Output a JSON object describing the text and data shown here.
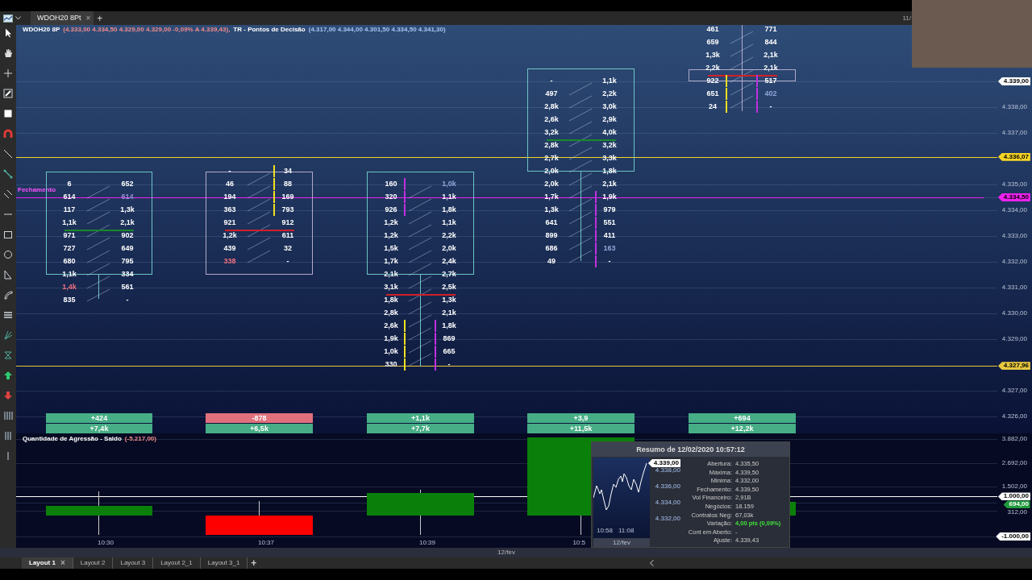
{
  "chart_tab": {
    "label": "WDOH20 8Pt",
    "close": "×"
  },
  "add_tab": "+",
  "clock_partial": "11/",
  "legend": {
    "symbol": "WDOH20 8P",
    "symbol_values": "(4.333,00  4.334,50  4.329,00  4.329,00  -0,09%  A 4.339,43),",
    "indicator": "TR - Pontos de Decisão",
    "indicator_values": "(4.317,00  4.344,00  4.301,50  4.334,50  4.341,30)"
  },
  "close_label": "Fechamento",
  "price_axis": [
    {
      "label": "4.339,00",
      "kind": "tag",
      "color": "#ffffff",
      "guide_line": false
    },
    {
      "label": "4.338,00",
      "kind": "tick"
    },
    {
      "label": "4.337,00",
      "kind": "tick"
    },
    {
      "label": "4.336,07",
      "kind": "tag",
      "color": "#f5d327",
      "guide_line": true
    },
    {
      "label": "4.335,00",
      "kind": "tick"
    },
    {
      "label": "4.334,50",
      "kind": "tag",
      "color": "#ee22ee",
      "guide_line": true
    },
    {
      "label": "4.334,00",
      "kind": "tick"
    },
    {
      "label": "4.333,00",
      "kind": "tick"
    },
    {
      "label": "4.332,00",
      "kind": "tick"
    },
    {
      "label": "4.331,00",
      "kind": "tick"
    },
    {
      "label": "4.330,00",
      "kind": "tick"
    },
    {
      "label": "4.329,00",
      "kind": "tick"
    },
    {
      "label": "4.327,96",
      "kind": "tag",
      "color": "#e8c840",
      "guide_line": true
    },
    {
      "label": "4.327,00",
      "kind": "tick"
    },
    {
      "label": "4.326,00",
      "kind": "tick"
    }
  ],
  "candles": [
    {
      "bullish": true,
      "poc_line": {
        "color": "#1a8a2a"
      },
      "delta": {
        "text": "+424",
        "positive": true
      },
      "total": "+7,4k",
      "rows": [
        {
          "bid": "6",
          "ask": "652",
          "poc": false
        },
        {
          "bid": "614",
          "ask": "614",
          "poc": false,
          "ask_highlight": {
            "color": "#9d8fd8"
          }
        },
        {
          "bid": "117",
          "ask": "1,3k",
          "poc": false
        },
        {
          "bid": "1,1k",
          "ask": "2,1k",
          "poc": false
        },
        {
          "bid": "971",
          "ask": "902",
          "poc": true
        },
        {
          "bid": "727",
          "ask": "649",
          "poc": false
        },
        {
          "bid": "680",
          "ask": "795",
          "poc": false
        },
        {
          "bid": "1,1k",
          "ask": "334",
          "poc": false
        },
        {
          "bid": "1,4k",
          "ask": "561",
          "poc": false,
          "bid_highlight": {
            "color": "#f07080"
          }
        },
        {
          "bid": "835",
          "ask": "-",
          "poc": false
        }
      ]
    },
    {
      "bullish": false,
      "poc_line": {
        "color": "#d0202a"
      },
      "delta": {
        "text": "-878",
        "positive": false
      },
      "total": "+6,5k",
      "rows": [
        {
          "bid": "-",
          "ask": "34",
          "poc": false,
          "ask_bar": {
            "color": "#f0e020"
          }
        },
        {
          "bid": "46",
          "ask": "88",
          "poc": false,
          "ask_bar": {
            "color": "#f0e020"
          }
        },
        {
          "bid": "194",
          "ask": "169",
          "poc": false,
          "ask_bar": {
            "color": "#f0e020"
          }
        },
        {
          "bid": "363",
          "ask": "793",
          "poc": false,
          "ask_bar": {
            "color": "#f0e020"
          }
        },
        {
          "bid": "921",
          "ask": "912",
          "poc": false
        },
        {
          "bid": "1,2k",
          "ask": "611",
          "poc": true
        },
        {
          "bid": "439",
          "ask": "32",
          "poc": false
        },
        {
          "bid": "338",
          "ask": "-",
          "poc": false,
          "bid_highlight": {
            "color": "#f07080"
          }
        }
      ]
    },
    {
      "bullish": true,
      "poc_line": {
        "color": "#d0202a"
      },
      "delta": {
        "text": "+1,1k",
        "positive": true
      },
      "total": "+7,7k",
      "rows": [
        {
          "bid": "160",
          "ask": "1,0k",
          "poc": false,
          "bid_bar": {
            "color": "#c030e0"
          },
          "ask_highlight": {
            "color": "#8fa5d8"
          }
        },
        {
          "bid": "320",
          "ask": "1,1k",
          "poc": false,
          "bid_bar": {
            "color": "#c030e0"
          }
        },
        {
          "bid": "926",
          "ask": "1,8k",
          "poc": false,
          "bid_bar": {
            "color": "#c030e0"
          }
        },
        {
          "bid": "1,2k",
          "ask": "1,1k",
          "poc": false
        },
        {
          "bid": "1,2k",
          "ask": "2,2k",
          "poc": false
        },
        {
          "bid": "1,5k",
          "ask": "2,0k",
          "poc": false
        },
        {
          "bid": "1,7k",
          "ask": "2,4k",
          "poc": false
        },
        {
          "bid": "2,1k",
          "ask": "2,7k",
          "poc": false
        },
        {
          "bid": "3,1k",
          "ask": "2,5k",
          "poc": false
        },
        {
          "bid": "1,8k",
          "ask": "1,3k",
          "poc": true
        },
        {
          "bid": "2,8k",
          "ask": "2,1k",
          "poc": false
        },
        {
          "bid": "2,6k",
          "ask": "1,8k",
          "poc": false,
          "bid_bar": {
            "color": "#f0e020"
          },
          "ask_bar": {
            "color": "#c030e0"
          }
        },
        {
          "bid": "1,9k",
          "ask": "869",
          "poc": false,
          "bid_bar": {
            "color": "#f0e020"
          },
          "ask_bar": {
            "color": "#c030e0"
          }
        },
        {
          "bid": "1,0k",
          "ask": "665",
          "poc": false,
          "bid_bar": {
            "color": "#f0e020"
          },
          "ask_bar": {
            "color": "#c030e0"
          }
        },
        {
          "bid": "330",
          "ask": "-",
          "poc": false,
          "bid_bar": {
            "color": "#f0e020"
          },
          "ask_bar": {
            "color": "#c030e0"
          }
        }
      ]
    },
    {
      "bullish": true,
      "poc_line": {
        "color": "#1a8a2a"
      },
      "delta": {
        "text": "+3,9",
        "positive": true
      },
      "total": "+11,5k",
      "rows": [
        {
          "bid": "-",
          "ask": "1,1k",
          "poc": false
        },
        {
          "bid": "497",
          "ask": "2,2k",
          "poc": false
        },
        {
          "bid": "2,8k",
          "ask": "3,0k",
          "poc": false
        },
        {
          "bid": "2,6k",
          "ask": "2,9k",
          "poc": false
        },
        {
          "bid": "3,2k",
          "ask": "4,0k",
          "poc": false
        },
        {
          "bid": "2,8k",
          "ask": "3,2k",
          "poc": true
        },
        {
          "bid": "2,7k",
          "ask": "3,3k",
          "poc": false
        },
        {
          "bid": "2,0k",
          "ask": "1,8k",
          "poc": false
        },
        {
          "bid": "2,0k",
          "ask": "2,1k",
          "poc": false
        },
        {
          "bid": "1,7k",
          "ask": "1,9k",
          "poc": false,
          "ask_bar": {
            "color": "#c030e0"
          }
        },
        {
          "bid": "1,3k",
          "ask": "979",
          "poc": false,
          "ask_bar": {
            "color": "#c030e0"
          }
        },
        {
          "bid": "641",
          "ask": "551",
          "poc": false,
          "ask_bar": {
            "color": "#c030e0"
          }
        },
        {
          "bid": "899",
          "ask": "411",
          "poc": false,
          "ask_bar": {
            "color": "#c030e0"
          }
        },
        {
          "bid": "686",
          "ask": "163",
          "poc": false,
          "ask_bar": {
            "color": "#c030e0"
          },
          "ask_highlight": {
            "color": "#8fa5d8"
          }
        },
        {
          "bid": "49",
          "ask": "-",
          "poc": false,
          "ask_bar": {
            "color": "#c030e0"
          }
        }
      ]
    },
    {
      "bullish": false,
      "poc_line": {
        "color": "#d0202a"
      },
      "delta": {
        "text": "+694",
        "positive": true
      },
      "total": "+12,2k",
      "rows": [
        {
          "bid": "461",
          "ask": "771",
          "poc": false
        },
        {
          "bid": "659",
          "ask": "844",
          "poc": false
        },
        {
          "bid": "1,3k",
          "ask": "2,1k",
          "poc": false
        },
        {
          "bid": "2,2k",
          "ask": "2,1k",
          "poc": false
        },
        {
          "bid": "922",
          "ask": "517",
          "poc": true,
          "bid_bar": {
            "color": "#f0e020"
          },
          "ask_bar": {
            "color": "#c030e0"
          }
        },
        {
          "bid": "651",
          "ask": "402",
          "poc": false,
          "bid_bar": {
            "color": "#f0e020"
          },
          "ask_bar": {
            "color": "#c030e0"
          },
          "ask_highlight": {
            "color": "#8fa5d8"
          }
        },
        {
          "bid": "24",
          "ask": "-",
          "poc": false,
          "bid_bar": {
            "color": "#f0e020"
          },
          "ask_bar": {
            "color": "#c030e0"
          }
        }
      ]
    }
  ],
  "lower_panel": {
    "title": "Quantidade de Agressão - Saldo",
    "value": "(-5.217,00)",
    "axis": [
      {
        "label": "3.882,00",
        "kind": "tick"
      },
      {
        "label": "2.692,00",
        "kind": "tick"
      },
      {
        "label": "1.502,00",
        "kind": "tick"
      },
      {
        "label": "1.000,00",
        "kind": "tag",
        "color": "#ffffff",
        "guide_line": true
      },
      {
        "label": "694,00",
        "kind": "tag",
        "color": "#1f9a3a",
        "guide_line": false
      },
      {
        "label": "312,00",
        "kind": "tick"
      },
      {
        "label": "-1.000,00",
        "kind": "tag",
        "color": "#ffffff",
        "guide_line": false
      }
    ]
  },
  "time_labels": [
    "10:30",
    "10:37",
    "10:39",
    "10:5"
  ],
  "date_label": "12/fev",
  "tooltip": {
    "title": "Resumo de 12/02/2020 10:57:12",
    "mini_axis": [
      {
        "label": "4.339,00",
        "kind": "tag"
      },
      {
        "label": "4.338,00",
        "kind": "tick"
      },
      {
        "label": "4.336,00",
        "kind": "tick"
      },
      {
        "label": "4.334,00",
        "kind": "tick"
      },
      {
        "label": "4.332,00",
        "kind": "tick"
      }
    ],
    "mini_times": [
      "10:58",
      "11:08"
    ],
    "mini_date": "12/fev",
    "fields": [
      {
        "label": "Abertura:",
        "value": "4.335,50",
        "emphasis": false
      },
      {
        "label": "Máxima:",
        "value": "4.339,50",
        "emphasis": false
      },
      {
        "label": "Minima:",
        "value": "4.332,00",
        "emphasis": false
      },
      {
        "label": "Fechamento:",
        "value": "4.339,50",
        "emphasis": false
      },
      {
        "label": "Vol Financeiro:",
        "value": "2,91B",
        "emphasis": false
      },
      {
        "label": "Negócios:",
        "value": "18.159",
        "emphasis": false
      },
      {
        "label": "Contratos Neg:",
        "value": "67,03k",
        "emphasis": false
      },
      {
        "label": "Variação:",
        "value": "4,00 pts (0,09%)",
        "emphasis": true
      },
      {
        "label": "Cont em Aberto:",
        "value": "-",
        "emphasis": false
      },
      {
        "label": "Ajuste:",
        "value": "4.339,43",
        "emphasis": false
      }
    ]
  },
  "layouts": [
    {
      "label": "Layout 1",
      "selected": true
    },
    {
      "label": "Layout 2",
      "selected": false
    },
    {
      "label": "Layout 3",
      "selected": false
    },
    {
      "label": "Layout 2_1",
      "selected": false
    },
    {
      "label": "Layout 3_1",
      "selected": false
    }
  ],
  "layout_close": "×",
  "layout_add": "+"
}
